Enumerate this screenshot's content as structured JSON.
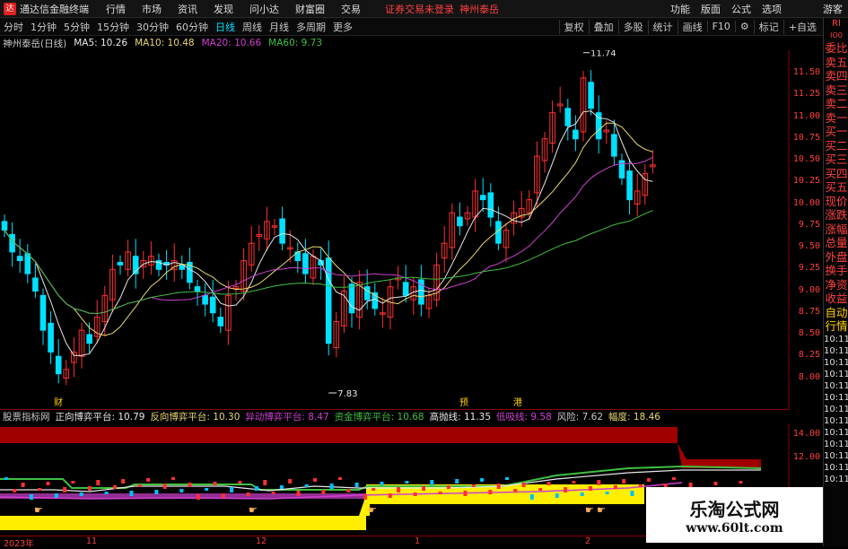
{
  "titlebar": {
    "logo": "达",
    "app_name": "通达信金融终端",
    "menus": [
      "行情",
      "市场",
      "资讯",
      "发现",
      "问小达",
      "财富圈",
      "交易"
    ],
    "login": "证券交易未登录",
    "stock": "神州泰岳",
    "right_menus": [
      "功能",
      "版面",
      "公式",
      "选项"
    ],
    "guest": "游客"
  },
  "periods": [
    "分时",
    "1分钟",
    "5分钟",
    "15分钟",
    "30分钟",
    "60分钟",
    "日线",
    "周线",
    "月线",
    "多周期",
    "更多"
  ],
  "active_period": "日线",
  "tools": [
    "复权",
    "叠加",
    "多股",
    "统计",
    "画线",
    "F10",
    "标记",
    "+自选"
  ],
  "info": {
    "name": "神州泰岳(日线)",
    "ma5": "MA5: 10.26",
    "ma10": "MA10: 10.48",
    "ma20": "MA20: 10.66",
    "ma60": "MA60: 9.73"
  },
  "colors": {
    "up": "#ff3030",
    "down": "#00e0ff",
    "ma5": "#e8e8e8",
    "ma10": "#e8d870",
    "ma20": "#d040d0",
    "ma60": "#40c040",
    "axis": "#8a0000"
  },
  "y_ticks": [
    "11.50",
    "11.25",
    "11.00",
    "10.75",
    "10.50",
    "10.25",
    "10.00",
    "9.75",
    "9.50",
    "9.25",
    "9.00",
    "8.75",
    "8.50",
    "8.25",
    "8.00"
  ],
  "annotations": {
    "high": "11.74",
    "low": "7.83",
    "tag_cai": "财",
    "tag_yu": "预",
    "tag_gang": "港"
  },
  "indicator": {
    "name": "股票指标网",
    "zx": "正向博弈平台: 10.79",
    "fx": "反向博弈平台: 10.30",
    "yd": "异动博弈平台: 8.47",
    "zj": "资金博弈平台: 10.68",
    "gp": "高抛线: 11.35",
    "dx": "低吸线: 9.58",
    "fx2": "风险: 7.62",
    "fd": "幅度: 18.46",
    "y_ticks": [
      "14.00",
      "12.00"
    ]
  },
  "sidebar": [
    "委比",
    "卖五",
    "卖四",
    "卖三",
    "卖二",
    "卖一",
    "买一",
    "买二",
    "买三",
    "买四",
    "买五",
    "现价",
    "涨跌",
    "涨幅",
    "总量",
    "外盘",
    "换手",
    "净资",
    "收益"
  ],
  "sidebar_yellow": [
    "自动",
    "行情"
  ],
  "sidebar_times": [
    "10:11",
    "10:11",
    "10:11",
    "10:11",
    "10:11",
    "10:11",
    "10:11",
    "10:11",
    "10:11",
    "10:11",
    "10:11",
    "10:11",
    "10:11"
  ],
  "sidebar_top": [
    "Rl",
    "IO0"
  ],
  "date_ticks": [
    "2023年",
    "11",
    "12",
    "1",
    "2"
  ],
  "watermark": {
    "line1": "乐淘公式网",
    "line2": "www.60lt.com"
  }
}
